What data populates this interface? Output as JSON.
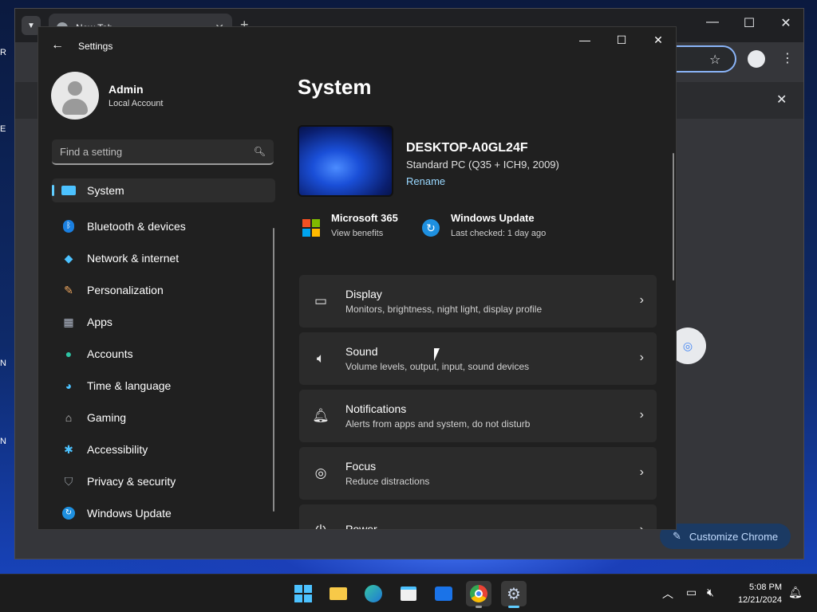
{
  "chrome": {
    "tab_title": "New Tab",
    "new_tab_symbol": "+",
    "customize_label": "Customize Chrome"
  },
  "desktop": {
    "labels": [
      "R",
      "E",
      "N",
      "N"
    ]
  },
  "settings": {
    "app_title": "Settings",
    "user": {
      "name": "Admin",
      "account_type": "Local Account"
    },
    "search_placeholder": "Find a setting",
    "nav": [
      {
        "label": "System",
        "icon": "system-icon",
        "active": true
      },
      {
        "label": "Bluetooth & devices",
        "icon": "bluetooth-icon"
      },
      {
        "label": "Network & internet",
        "icon": "wifi-icon"
      },
      {
        "label": "Personalization",
        "icon": "brush-icon"
      },
      {
        "label": "Apps",
        "icon": "apps-icon"
      },
      {
        "label": "Accounts",
        "icon": "accounts-icon"
      },
      {
        "label": "Time & language",
        "icon": "globe-clock-icon"
      },
      {
        "label": "Gaming",
        "icon": "gamepad-icon"
      },
      {
        "label": "Accessibility",
        "icon": "accessibility-icon"
      },
      {
        "label": "Privacy & security",
        "icon": "shield-icon"
      },
      {
        "label": "Windows Update",
        "icon": "update-icon"
      }
    ],
    "page_title": "System",
    "device": {
      "name": "DESKTOP-A0GL24F",
      "model": "Standard PC (Q35 + ICH9, 2009)",
      "rename": "Rename"
    },
    "quick": [
      {
        "title": "Microsoft 365",
        "subtitle": "View benefits",
        "icon": "microsoft-logo-icon"
      },
      {
        "title": "Windows Update",
        "subtitle": "Last checked: 1 day ago",
        "icon": "windows-update-icon"
      }
    ],
    "cards": [
      {
        "title": "Display",
        "desc": "Monitors, brightness, night light, display profile",
        "icon": "display-icon"
      },
      {
        "title": "Sound",
        "desc": "Volume levels, output, input, sound devices",
        "icon": "speaker-icon"
      },
      {
        "title": "Notifications",
        "desc": "Alerts from apps and system, do not disturb",
        "icon": "bell-icon"
      },
      {
        "title": "Focus",
        "desc": "Reduce distractions",
        "icon": "focus-icon"
      },
      {
        "title": "Power",
        "desc": "",
        "icon": "power-icon"
      }
    ]
  },
  "taskbar": {
    "time": "5:08 PM",
    "date": "12/21/2024"
  },
  "colors": {
    "accent": "#60cdff",
    "chrome_accent": "#8ab4f8",
    "card_bg": "#2b2b2b",
    "window_bg": "#202020"
  }
}
